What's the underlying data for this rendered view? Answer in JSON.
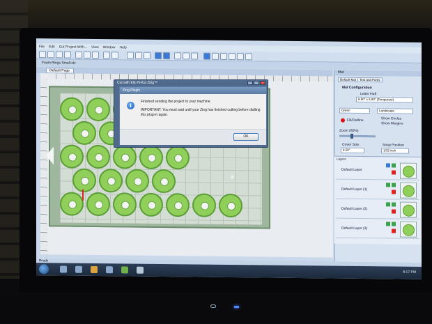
{
  "window": {
    "title": "Cut Project With...",
    "menu": [
      "File",
      "Edit",
      "Cut Project With...",
      "View",
      "Window",
      "Help"
    ]
  },
  "project_bar": {
    "label": "Foam Rings Small.stc"
  },
  "document_tab": {
    "label": "Default Page"
  },
  "right_panel": {
    "header": "Mat",
    "tabs": [
      "Default Mat",
      "Text and Fonts"
    ],
    "mat_configuration_label": "Mat Configuration",
    "mat_size_name": "Letter Half",
    "mat_size_dims": "8.50\" x 5.50\" (Temporary)",
    "color_label": "Green",
    "orientation_label": "Landscape",
    "fill_outline_label": "Fill/Outline",
    "show_circles_label": "Show Circles",
    "show_margins_label": "Show Margins",
    "zoom_label": "Zoom (80%)",
    "cover_size_label": "Cover Size",
    "cover_size_value": "8.50\"",
    "snap_position_label": "Snap Position",
    "snap_position_value": "1/32 inch"
  },
  "layers": {
    "header": "Layers",
    "items": [
      "Default Layer",
      "Default Layer (1)",
      "Default Layer (2)",
      "Default Layer (3)"
    ]
  },
  "status_bar": {
    "text": "Ready"
  },
  "taskbar": {
    "clock": "8:17 PM"
  },
  "outer_dialog": {
    "title": "Cut with Klic-N-Kut Zing™"
  },
  "inner_dialog": {
    "title": "Zing Plugin",
    "message_line1": "Finished sending the project to your machine.",
    "message_line2": "IMPORTANT: You must wait until your Zing has finished cutting before dialling this plug-in again.",
    "ok_label": "OK"
  },
  "colors": {
    "ring_fill": "#8fcf5a",
    "ring_border": "#5a9c36",
    "mat": "#9fb79e",
    "dialog_accent": "#3b78c0",
    "power_led": "#4d86ff"
  },
  "icons": [
    "windows-start-icon",
    "info-icon",
    "close-icon",
    "minimize-icon",
    "maximize-icon"
  ]
}
